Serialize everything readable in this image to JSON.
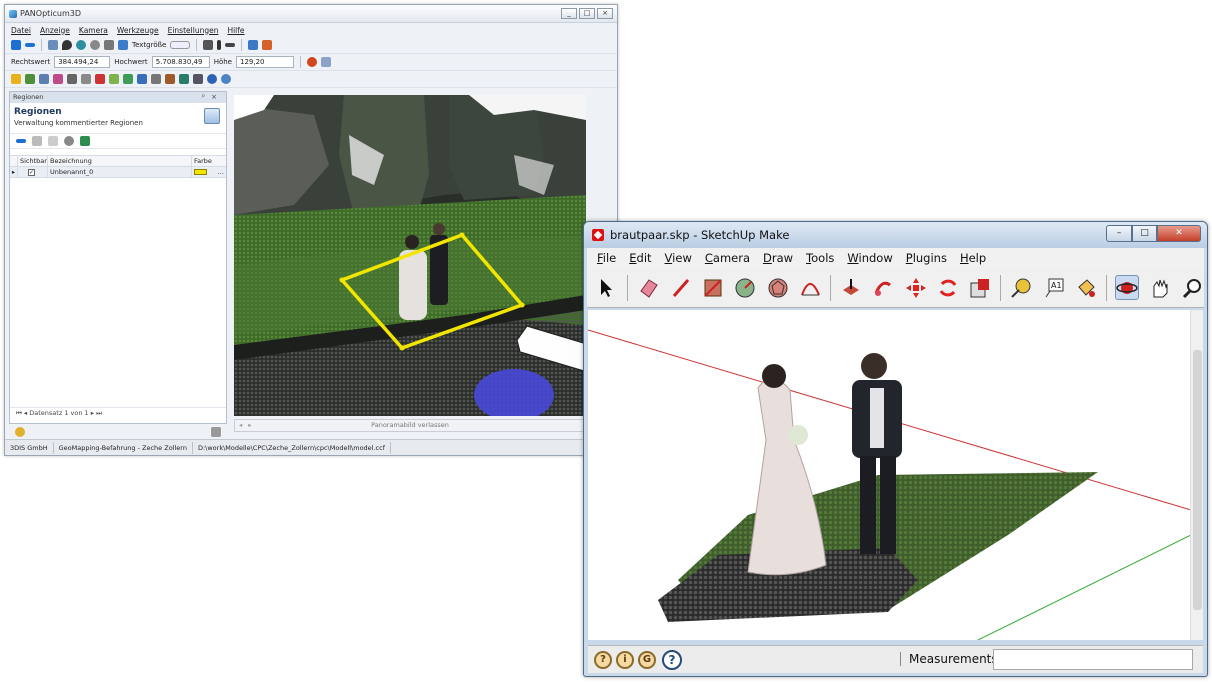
{
  "panopticum": {
    "title": "PANOpticum3D",
    "window_buttons": [
      "_",
      "□",
      "×"
    ],
    "menu": [
      "Datei",
      "Anzeige",
      "Kamera",
      "Werkzeuge",
      "Einstellungen",
      "Hilfe"
    ],
    "toolbar": {
      "text_size_label": "Textgröße"
    },
    "coords": {
      "rechtswert_label": "Rechtswert",
      "rechtswert_value": "384.494,24",
      "hochwert_label": "Hochwert",
      "hochwert_value": "5.708.830,49",
      "hoehe_label": "Höhe",
      "hoehe_value": "129,20"
    },
    "panel": {
      "header": "Regionen",
      "title": "Regionen",
      "subtitle": "Verwaltung kommentierter Regionen",
      "columns": [
        "Sichtbar",
        "Bezeichnung",
        "Farbe"
      ],
      "rows": [
        {
          "name": "Unbenannt_0",
          "visible": true,
          "color": "#f4e500"
        }
      ],
      "pager": "Datensatz 1 von 1"
    },
    "view_footer": "Panoramabild verlassen",
    "status": [
      "3DIS GmbH",
      "GeoMapping-Befahrung - Zeche Zollern",
      "D:\\work\\Modelle\\CPC\\Zeche_Zollern\\cpc\\Modell\\model.ccf"
    ]
  },
  "sketchup": {
    "title": "brautpaar.skp - SketchUp Make",
    "window_buttons": [
      "–",
      "□",
      "✕"
    ],
    "menu": [
      "File",
      "Edit",
      "View",
      "Camera",
      "Draw",
      "Tools",
      "Window",
      "Plugins",
      "Help"
    ],
    "toolbar_icons": [
      "select-icon",
      "eraser-icon",
      "pencil-icon",
      "rectangle-icon",
      "circle-icon",
      "polygon-icon",
      "arc-icon",
      "push-pull-icon",
      "follow-me-icon",
      "move-icon",
      "rotate-icon",
      "scale-icon",
      "tape-measure-icon",
      "text-icon",
      "paint-bucket-icon",
      "orbit-icon",
      "pan-icon",
      "zoom-icon"
    ],
    "measurements_label": "Measurements",
    "measurements_value": ""
  },
  "colors": {
    "region_outline": "#f2e600",
    "marker": "#4848d8",
    "red_axis": "#c33",
    "green_axis": "#3a3"
  }
}
